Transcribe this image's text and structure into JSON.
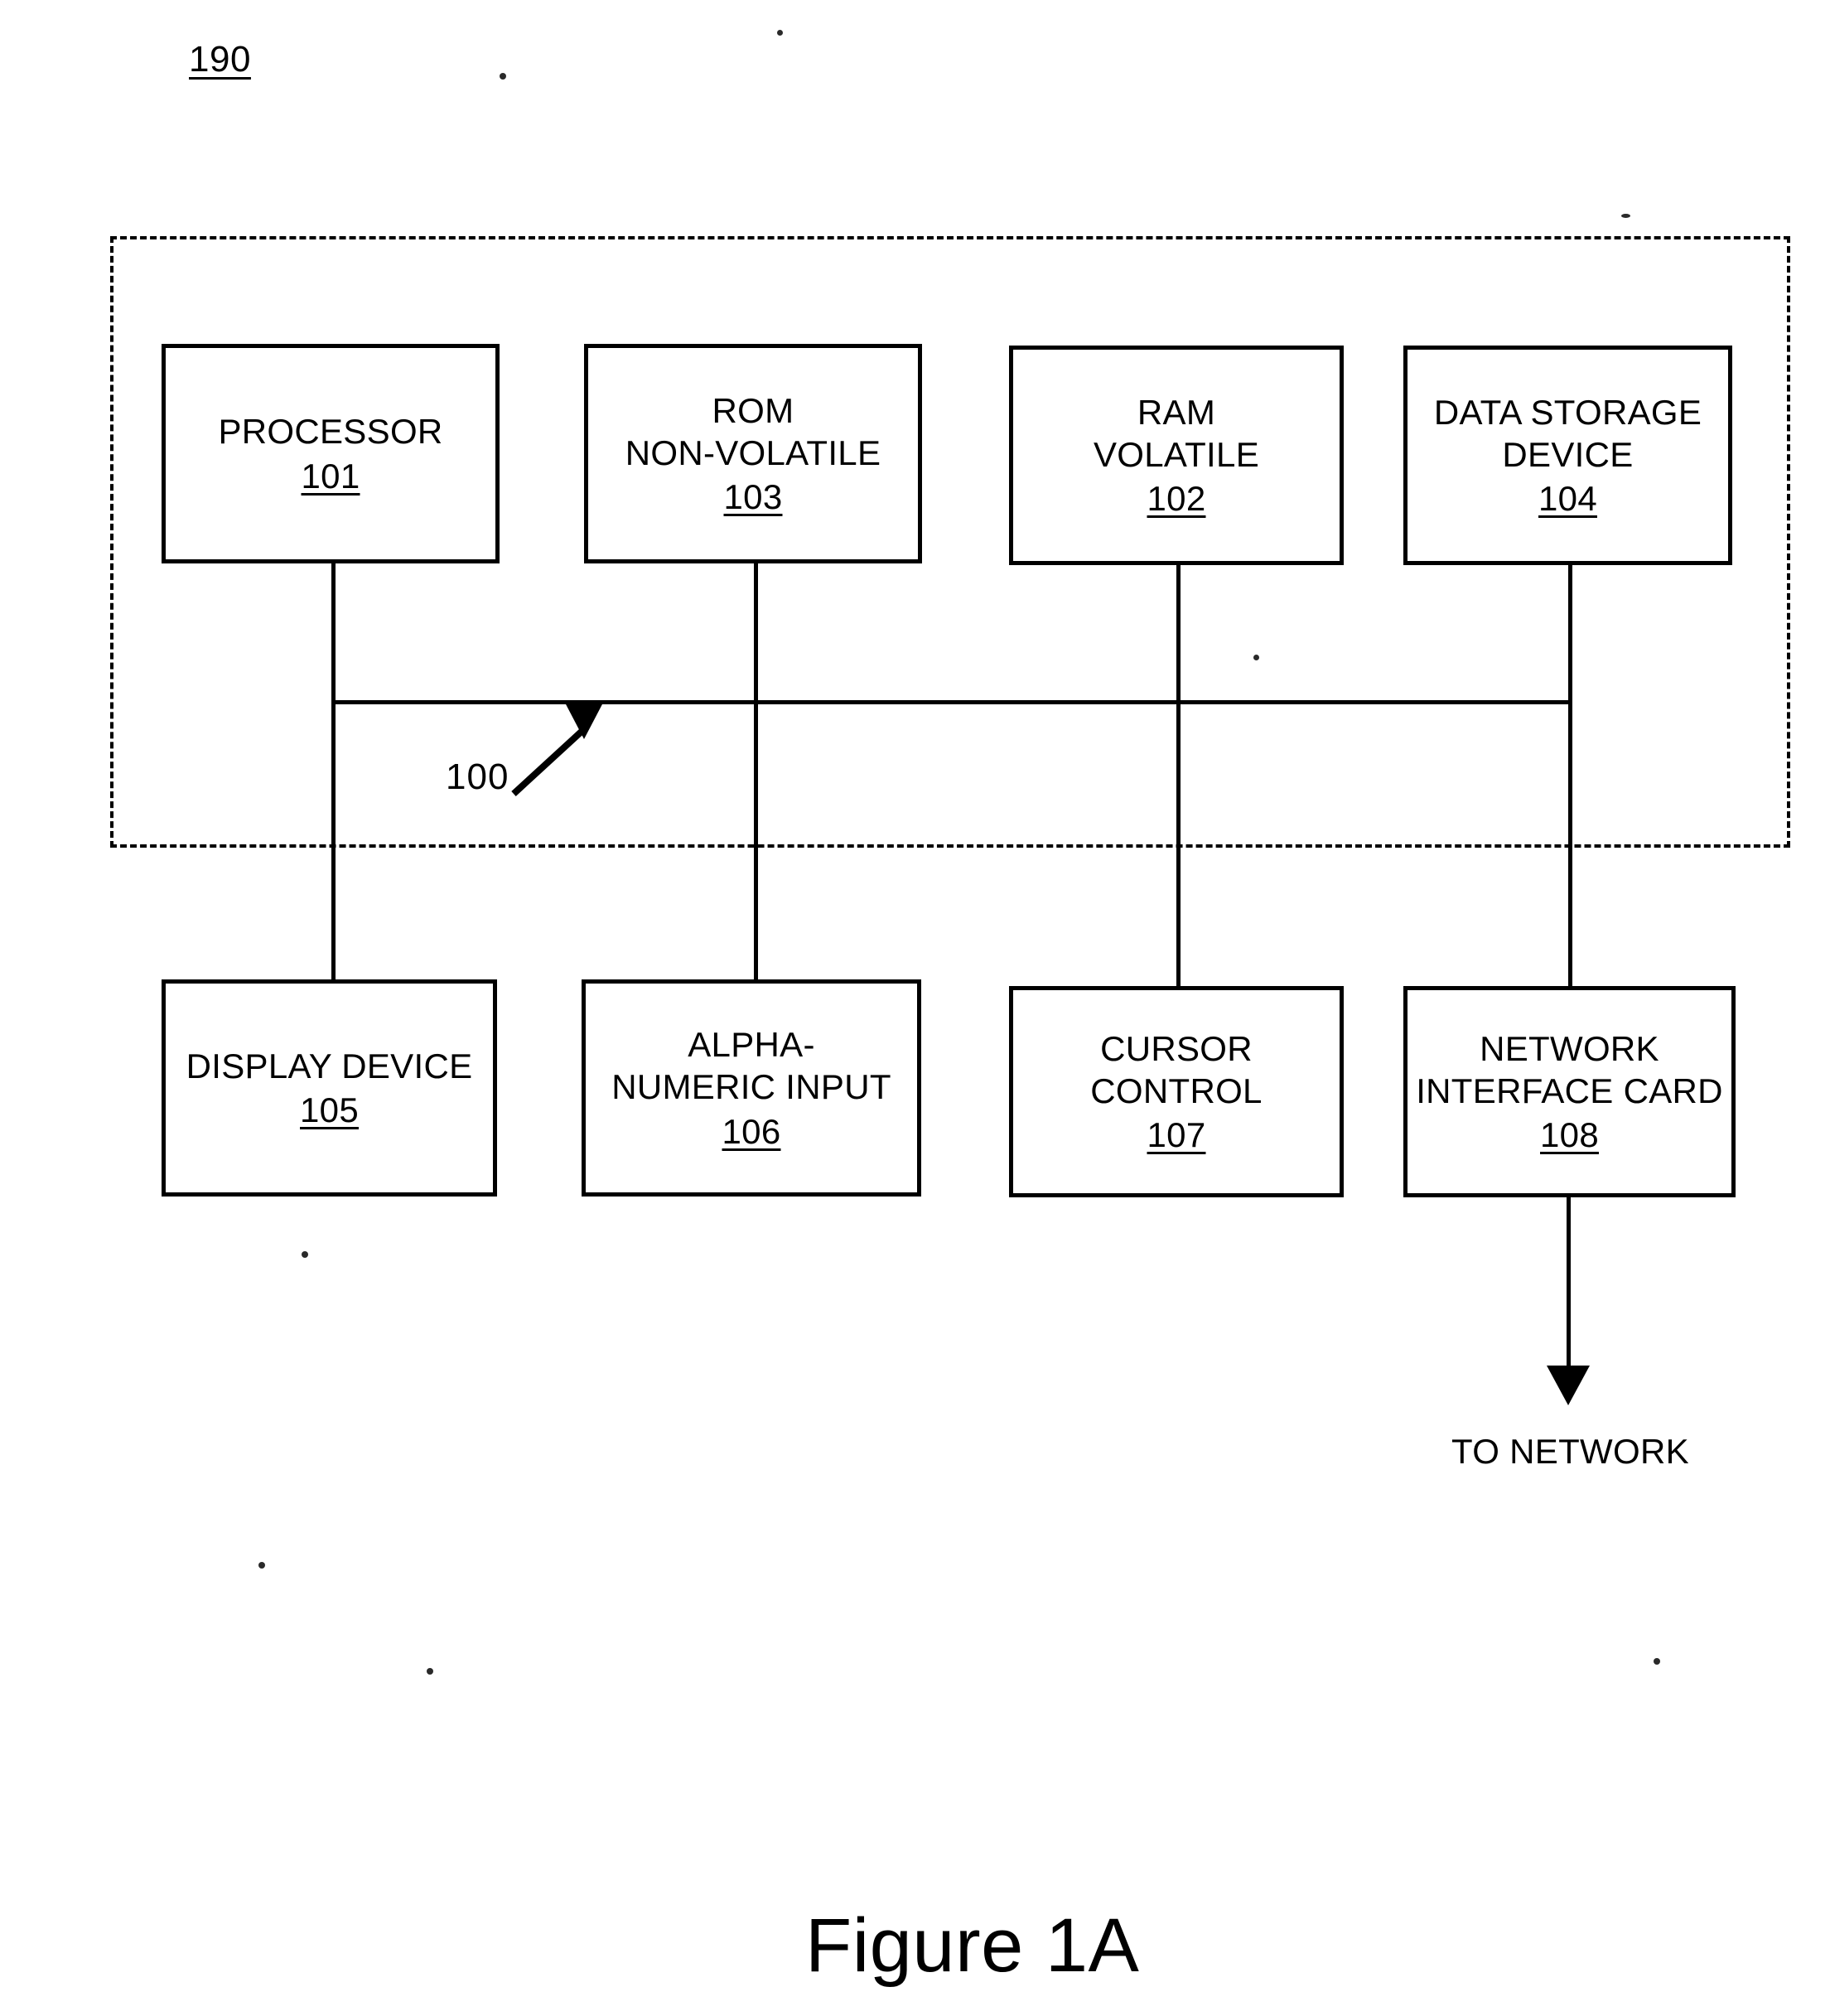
{
  "figure": {
    "caption": "Figure 1A",
    "system_reference_numeral": "190",
    "bus_reference_numeral": "100",
    "network_label": "TO NETWORK"
  },
  "diagram": {
    "type": "block-diagram",
    "enclosure": {
      "name": "computer-system-boundary",
      "style": "dashed"
    },
    "internal_components": [
      {
        "id": "processor",
        "label": "PROCESSOR",
        "number": "101"
      },
      {
        "id": "rom",
        "label": "ROM\nNON-VOLATILE",
        "number": "103"
      },
      {
        "id": "ram",
        "label": "RAM\nVOLATILE",
        "number": "102"
      },
      {
        "id": "data_storage",
        "label": "DATA STORAGE\nDEVICE",
        "number": "104"
      }
    ],
    "peripheral_components": [
      {
        "id": "display",
        "label": "DISPLAY DEVICE",
        "number": "105"
      },
      {
        "id": "keyboard",
        "label": "ALPHA-\nNUMERIC INPUT",
        "number": "106"
      },
      {
        "id": "cursor",
        "label": "CURSOR\nCONTROL",
        "number": "107"
      },
      {
        "id": "nic",
        "label": "NETWORK\nINTERFACE CARD",
        "number": "108"
      }
    ],
    "bus": {
      "name": "address-data-bus",
      "reference": "100"
    }
  },
  "colors": {
    "ink": "#000000",
    "paper": "#ffffff"
  }
}
